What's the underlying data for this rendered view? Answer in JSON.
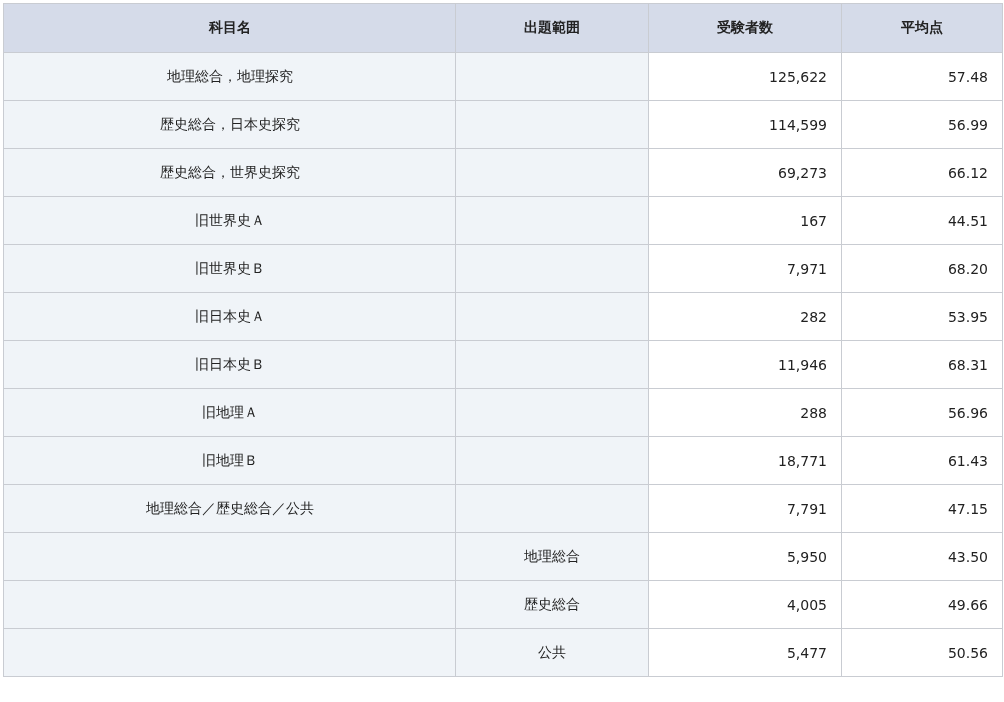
{
  "table": {
    "columns": [
      "科目名",
      "出題範囲",
      "受験者数",
      "平均点"
    ],
    "rows": [
      {
        "subject": "地理総合，地理探究",
        "examinees": "125,622",
        "average": "57.48"
      },
      {
        "subject": "歴史総合，日本史探究",
        "examinees": "114,599",
        "average": "56.99"
      },
      {
        "subject": "歴史総合，世界史探究",
        "examinees": "69,273",
        "average": "66.12"
      },
      {
        "subject": "旧世界史Ａ",
        "examinees": "167",
        "average": "44.51"
      },
      {
        "subject": "旧世界史Ｂ",
        "examinees": "7,971",
        "average": "68.20"
      },
      {
        "subject": "旧日本史Ａ",
        "examinees": "282",
        "average": "53.95"
      },
      {
        "subject": "旧日本史Ｂ",
        "examinees": "11,946",
        "average": "68.31"
      },
      {
        "subject": "旧地理Ａ",
        "examinees": "288",
        "average": "56.96"
      },
      {
        "subject": "旧地理Ｂ",
        "examinees": "18,771",
        "average": "61.43"
      },
      {
        "subject": "地理総合／歴史総合／公共",
        "examinees": "7,791",
        "average": "47.15"
      },
      {
        "scope": "地理総合",
        "examinees": "5,950",
        "average": "43.50"
      },
      {
        "scope": "歴史総合",
        "examinees": "4,005",
        "average": "49.66"
      },
      {
        "scope": "公共",
        "examinees": "5,477",
        "average": "50.56"
      }
    ]
  }
}
